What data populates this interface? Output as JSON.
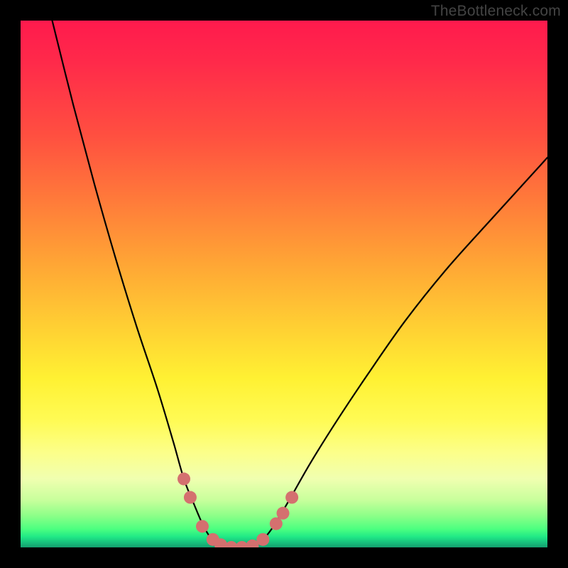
{
  "watermark": "TheBottleneck.com",
  "chart_data": {
    "type": "line",
    "title": "",
    "xlabel": "",
    "ylabel": "",
    "xlim": [
      0,
      100
    ],
    "ylim": [
      0,
      100
    ],
    "series": [
      {
        "name": "left-curve",
        "x": [
          6,
          10,
          14,
          18,
          22,
          26,
          29,
          31,
          33,
          34.5,
          35.8,
          37,
          38
        ],
        "values": [
          100,
          84,
          69,
          55,
          42,
          30,
          20,
          13,
          8,
          4.5,
          2.2,
          0.8,
          0.3
        ]
      },
      {
        "name": "right-curve",
        "x": [
          44,
          46,
          48,
          51,
          55,
          60,
          66,
          73,
          81,
          90,
          100
        ],
        "values": [
          0.3,
          1.5,
          4,
          9,
          16,
          24,
          33,
          43,
          53,
          63,
          74
        ]
      },
      {
        "name": "valley-bottom",
        "x": [
          38,
          39.5,
          41,
          42.5,
          44
        ],
        "values": [
          0.3,
          0,
          0,
          0,
          0.3
        ]
      }
    ],
    "markers": {
      "name": "highlight-dots",
      "color": "#d4706f",
      "points": [
        {
          "x": 31.0,
          "y": 13.0
        },
        {
          "x": 32.2,
          "y": 9.5
        },
        {
          "x": 34.5,
          "y": 4.0
        },
        {
          "x": 36.5,
          "y": 1.5
        },
        {
          "x": 38.0,
          "y": 0.5
        },
        {
          "x": 40.0,
          "y": 0.0
        },
        {
          "x": 42.0,
          "y": 0.0
        },
        {
          "x": 44.0,
          "y": 0.3
        },
        {
          "x": 46.0,
          "y": 1.5
        },
        {
          "x": 48.5,
          "y": 4.5
        },
        {
          "x": 49.8,
          "y": 6.5
        },
        {
          "x": 51.5,
          "y": 9.5
        }
      ]
    }
  }
}
